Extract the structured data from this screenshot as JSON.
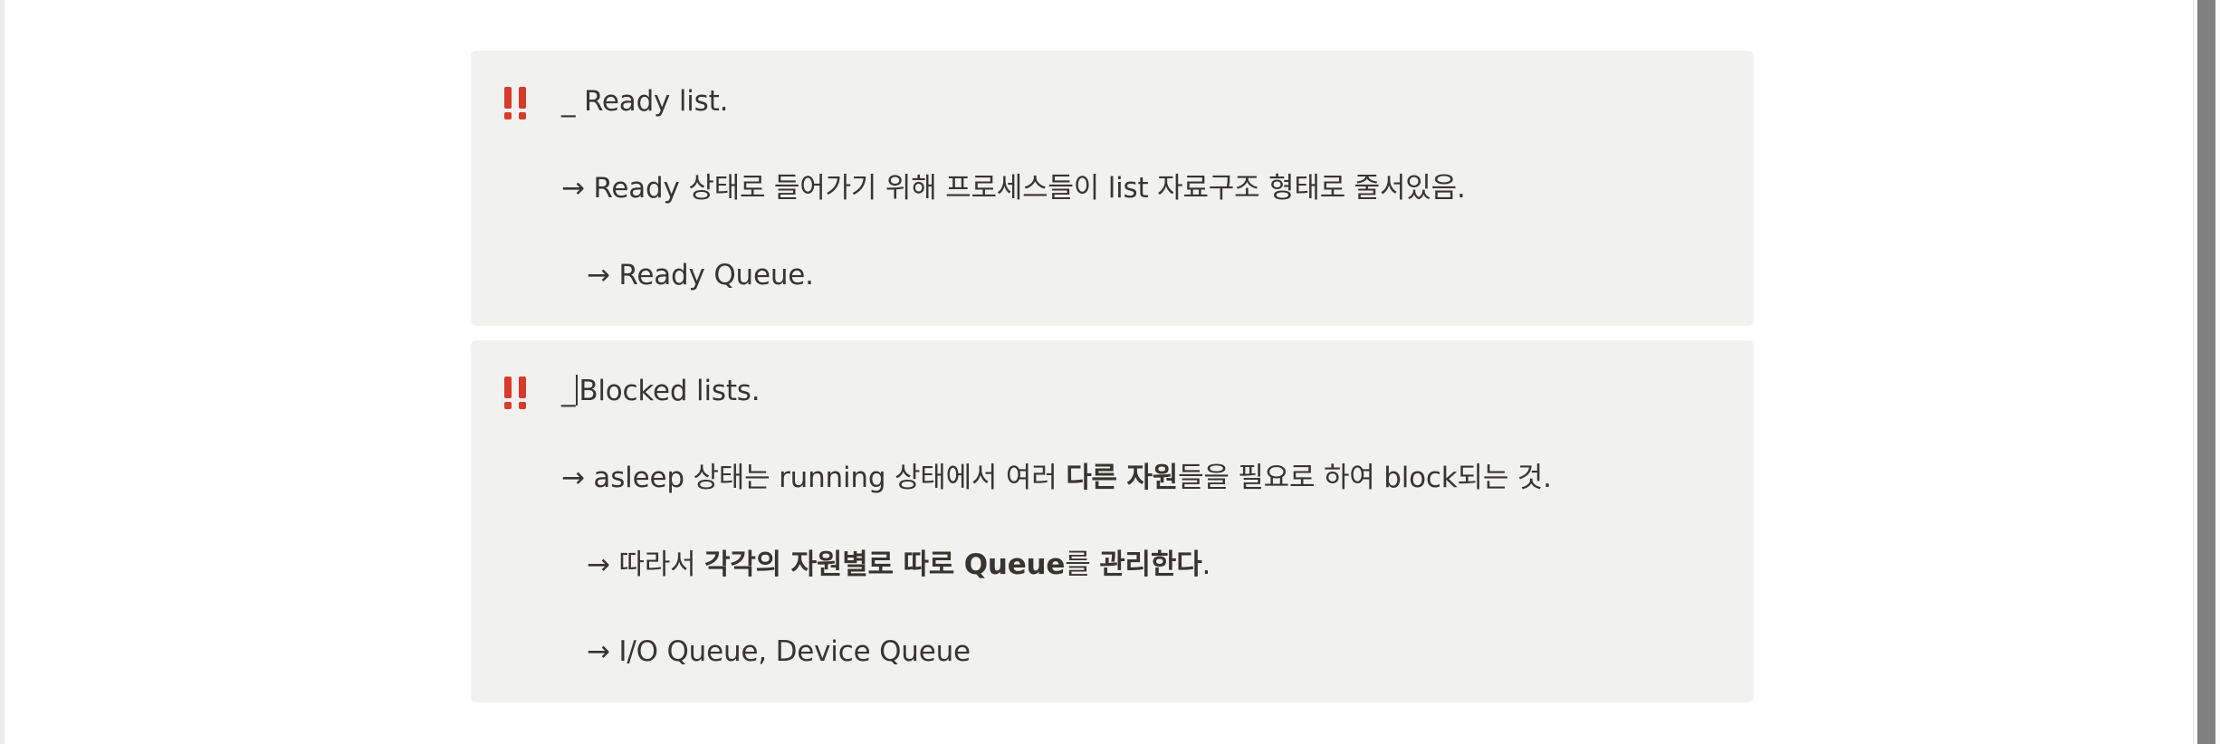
{
  "callouts": [
    {
      "icon": "double-exclamation-icon",
      "lines": {
        "l1": "_ Ready list.",
        "l2": "→ Ready 상태로 들어가기 위해 프로세스들이 list 자료구조 형태로 줄서있음.",
        "l3": "→ Ready Queue."
      }
    },
    {
      "icon": "double-exclamation-icon",
      "lines": {
        "l1_prefix": "_",
        "l1_text": "Blocked lists.",
        "l2": {
          "p1": "→ asleep 상태는 running 상태에서 여러 ",
          "b1": "다른 자원",
          "p2": "들을 필요로 하여 block되는 것."
        },
        "l3": {
          "p1": "→ 따라서 ",
          "b1": "각각의 자원별로 따로 Queue",
          "p2": "를 ",
          "b2": "관리한다",
          "p3": "."
        },
        "l4": "→ I/O Queue, Device Queue"
      }
    }
  ],
  "colors": {
    "callout_bg": "#f1f1ef",
    "icon_red": "#d93a2b",
    "text": "#37352f"
  }
}
